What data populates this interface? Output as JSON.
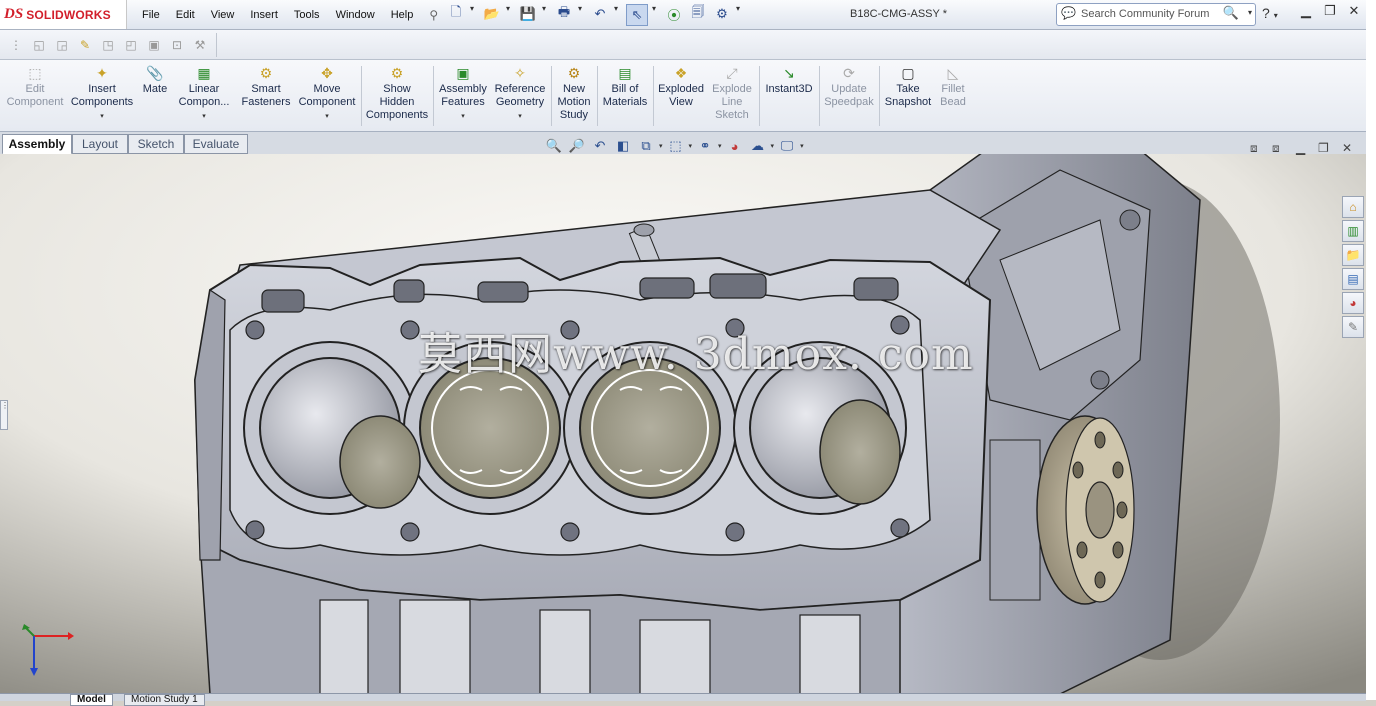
{
  "app": {
    "logo_ds": "DS",
    "logo_name": "SOLIDWORKS",
    "document_title": "B18C-CMG-ASSY *"
  },
  "menu": [
    "File",
    "Edit",
    "View",
    "Insert",
    "Tools",
    "Window",
    "Help"
  ],
  "search": {
    "placeholder": "Search Community Forum"
  },
  "command_manager": [
    {
      "label1": "Edit",
      "label2": "Component",
      "disabled": true
    },
    {
      "label1": "Insert",
      "label2": "Components",
      "has_dropdown": true
    },
    {
      "label1": "Mate"
    },
    {
      "label1": "Linear",
      "label2": "Compon...",
      "has_dropdown": true
    },
    {
      "label1": "Smart",
      "label2": "Fasteners"
    },
    {
      "label1": "Move",
      "label2": "Component",
      "has_dropdown": true
    },
    {
      "label1": "Show",
      "label2": "Hidden",
      "label3": "Components"
    },
    {
      "label1": "Assembly",
      "label2": "Features",
      "has_dropdown": true
    },
    {
      "label1": "Reference",
      "label2": "Geometry",
      "has_dropdown": true
    },
    {
      "label1": "New",
      "label2": "Motion",
      "label3": "Study"
    },
    {
      "label1": "Bill of",
      "label2": "Materials"
    },
    {
      "label1": "Exploded",
      "label2": "View"
    },
    {
      "label1": "Explode",
      "label2": "Line",
      "label3": "Sketch",
      "disabled": true
    },
    {
      "label1": "Instant3D"
    },
    {
      "label1": "Update",
      "label2": "Speedpak",
      "disabled": true
    },
    {
      "label1": "Take",
      "label2": "Snapshot"
    },
    {
      "label1": "Fillet",
      "label2": "Bead",
      "disabled": true
    }
  ],
  "tabs": [
    "Assembly",
    "Layout",
    "Sketch",
    "Evaluate"
  ],
  "active_tab": "Assembly",
  "watermark_text": "莫西网www. 3dmox. com",
  "bottom_tabs": [
    "Model",
    "Motion Study 1"
  ],
  "colors": {
    "brand_red": "#d21f2b",
    "viewport_bg": "#f2f0ea",
    "part_gray": "#b9bcc6",
    "piston": "#9a9788"
  }
}
